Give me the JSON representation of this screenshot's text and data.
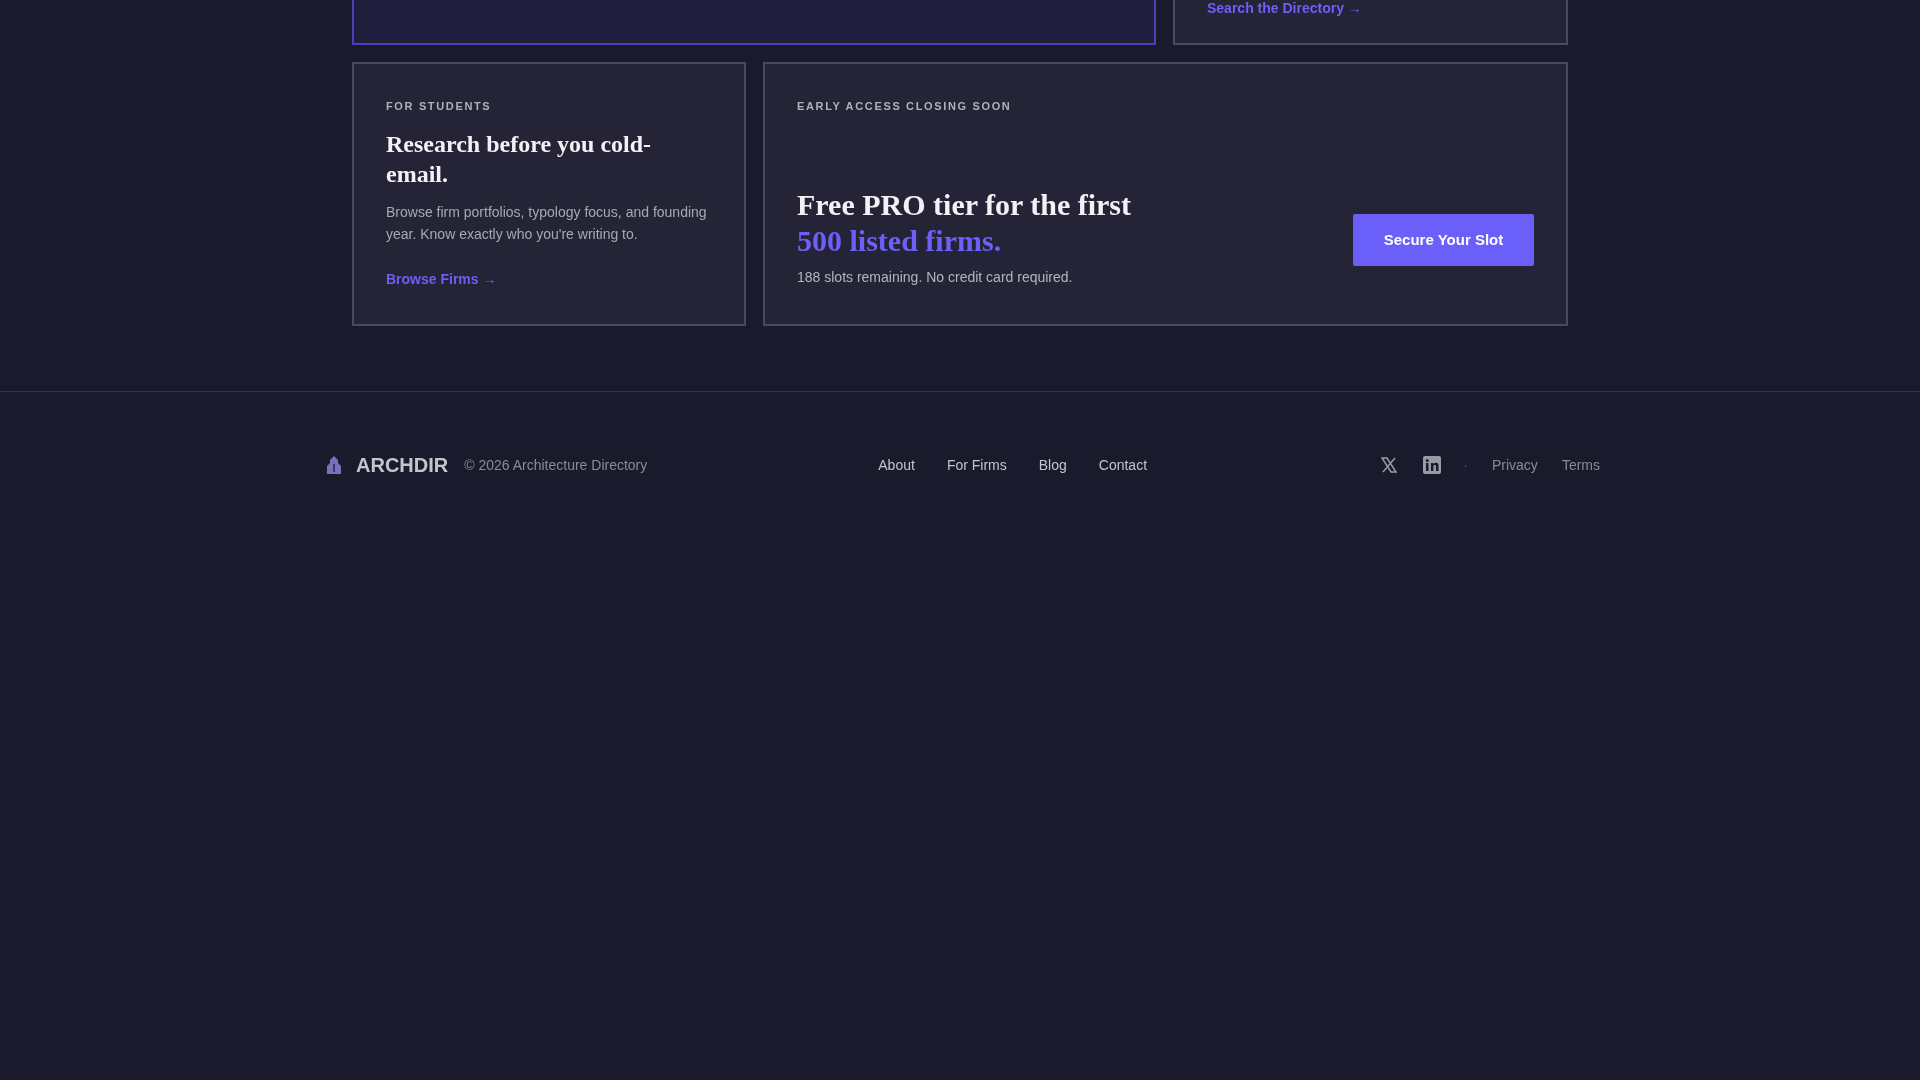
{
  "top_cards": [
    {
      "kind": "highlight"
    },
    {
      "kind": "link",
      "link": "Search the Directory",
      "arrow": "→"
    }
  ],
  "student_card": {
    "eyebrow": "FOR STUDENTS",
    "title": "Research before you cold-email.",
    "body": "Browse firm portfolios, typology focus, and founding year. Know exactly who you're writing to.",
    "link": "Browse Firms",
    "arrow": "→"
  },
  "promo_card": {
    "eyebrow": "EARLY ACCESS CLOSING SOON",
    "headline": "Free PRO tier for the first",
    "headline_accent": "500 listed firms.",
    "note": "188 slots remaining. No credit card required.",
    "button": "Secure Your Slot"
  },
  "footer": {
    "brand": "ARCHDIR",
    "copyright": "© 2026 Architecture Directory",
    "nav": [
      "About",
      "For Firms",
      "Blog",
      "Contact"
    ],
    "separator": "·",
    "legal": [
      "Privacy",
      "Terms"
    ]
  }
}
